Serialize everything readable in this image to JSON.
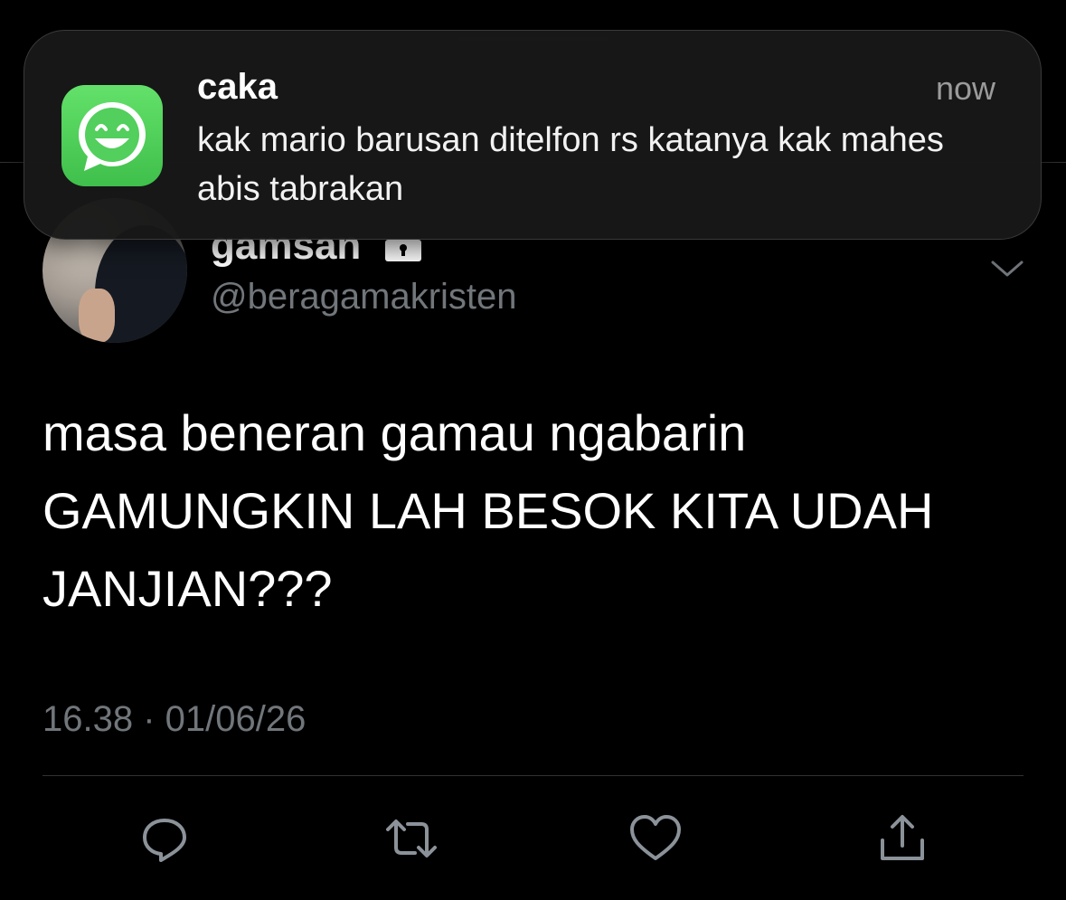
{
  "notification": {
    "app_icon": "whatsapp-smiley-icon",
    "sender": "caka",
    "time": "now",
    "message": "kak mario barusan ditelfon rs katanya kak mahes abis tabrakan"
  },
  "author": {
    "display_name": "gamsan",
    "lock_icon": "lock-icon",
    "handle": "@beragamakristen",
    "more_icon": "chevron-down-icon"
  },
  "tweet": {
    "text": "masa beneran gamau ngabarin\nGAMUNGKIN LAH BESOK KITA UDAH\nJANJIAN???",
    "timestamp": "16.38 · 01/06/26"
  },
  "actions": [
    {
      "name": "reply",
      "icon": "reply-icon"
    },
    {
      "name": "retweet",
      "icon": "retweet-icon"
    },
    {
      "name": "like",
      "icon": "heart-icon"
    },
    {
      "name": "share",
      "icon": "share-icon"
    }
  ],
  "colors": {
    "background": "#000000",
    "secondary_text": "#71767b",
    "notification_bg": "#181818",
    "app_icon_green": "#4fd15a"
  }
}
